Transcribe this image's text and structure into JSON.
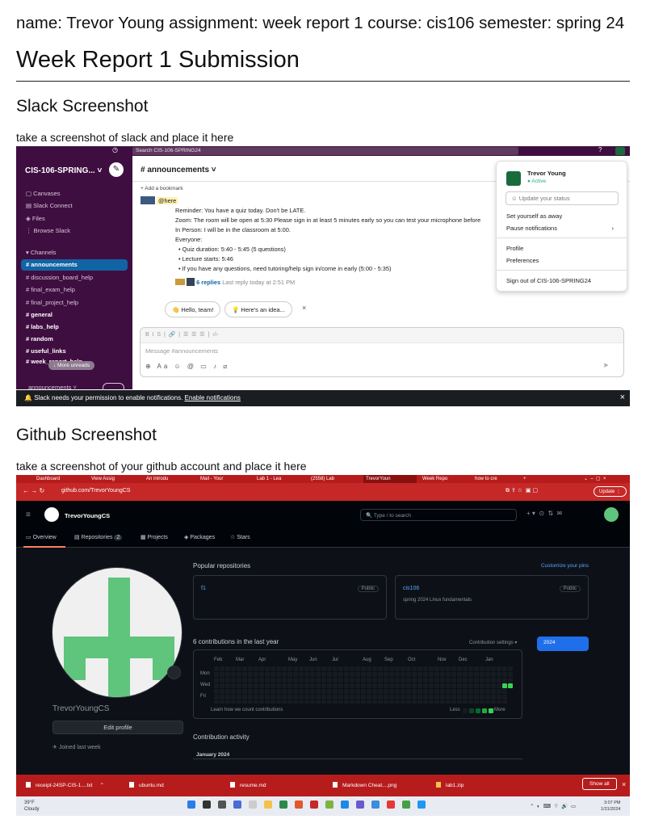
{
  "meta_line": "name: Trevor Young assignment: week report 1 course: cis106 semester: spring 24",
  "title": "Week Report 1 Submission",
  "slack_section": {
    "heading": "Slack Screenshot",
    "caption": "take a screenshot of slack and place it here",
    "search": "Search CIS-106-SPRING24",
    "workspace": "CIS-106-SPRING... ˅",
    "sidebar_top": [
      "Canvases",
      "Slack Connect",
      "Files",
      "Browse Slack"
    ],
    "channels_label": "Channels",
    "channels": [
      "announcements",
      "discussion_board_help",
      "final_exam_help",
      "final_project_help",
      "general",
      "labs_help",
      "random",
      "useful_links",
      "week_report_help"
    ],
    "more_unreads": "↓ More unreads",
    "bottom_label": "announcements ˅",
    "channel_title": "# announcements ˅",
    "add_bookmark": "+ Add a bookmark",
    "message": {
      "here": "@here",
      "lines": [
        "Reminder: You have a quiz today. Don't be LATE.",
        "Zoom: The room will be open at  5:30 Please sign in at least 5 minutes early so you can test your microphone before",
        "In Person: I will be in the classroom at 5:00.",
        "Everyone:",
        "•  Quiz duration: 5:40 - 5:45 (5 questions)",
        "•  Lecture starts: 5:46",
        "•  If you have any questions, need tutoring/help sign in/come in early (5:00 - 5:35)"
      ],
      "replies": "6 replies",
      "last_reply": "Last reply today at 2:51 PM"
    },
    "chips": [
      "👋 Hello, team!",
      "💡 Here's an idea..."
    ],
    "composer_placeholder": "Message #announcements",
    "profile": {
      "name": "Trevor Young",
      "status": "● Active",
      "update_status": "Update your status",
      "set_away": "Set yourself as away",
      "pause": "Pause notifications",
      "profile": "Profile",
      "preferences": "Preferences",
      "sign_out": "Sign out of CIS-106-SPRING24"
    },
    "notice": "Slack needs your permission to enable notifications.",
    "notice_link": "Enable notifications"
  },
  "github_section": {
    "heading": "Github Screenshot",
    "caption": "take a screenshot of your github account and place it here",
    "tabs": [
      "Dashboard",
      "View Assig",
      "An introdu",
      "Mail - Your",
      "Lab 1 - Lea",
      "(2558) Lab",
      "TrevorYoun",
      "Week Repo",
      "how to cre"
    ],
    "url": "github.com/TrevorYoungCS",
    "update": "Update ⋮",
    "username": "TrevorYoungCS",
    "search": "Type / to search",
    "nav": [
      "Overview",
      "Repositories",
      "Projects",
      "Packages",
      "Stars"
    ],
    "repo_count": "2",
    "profile_name": "TrevorYoungCS",
    "edit_profile": "Edit profile",
    "joined": "Joined last week",
    "popular": "Popular repositories",
    "customize": "Customize your pins",
    "repos": [
      {
        "name": "f1",
        "visibility": "Public",
        "desc": ""
      },
      {
        "name": "cis106",
        "visibility": "Public",
        "desc": "spring 2024 Linux fundamentals"
      }
    ],
    "contrib_title": "6 contributions in the last year",
    "contrib_settings": "Contribution settings ▾",
    "year": "2024",
    "months": [
      "Feb",
      "Mar",
      "Apr",
      "May",
      "Jun",
      "Jul",
      "Aug",
      "Sep",
      "Oct",
      "Nov",
      "Dec",
      "Jan"
    ],
    "days": [
      "Mon",
      "Wed",
      "Fri"
    ],
    "learn": "Learn how we count contributions",
    "less": "Less",
    "more": "More",
    "activity": "Contribution activity",
    "january": "January 2024",
    "downloads": [
      "receipt-24SP-CIS-1....txt",
      "ubuntu.md",
      "resume.md",
      "Markdown Cheat....png",
      "lab1.zip"
    ],
    "show_all": "Show all",
    "weather_temp": "39°F",
    "weather_cond": "Cloudy",
    "time": "3:07 PM",
    "date": "1/31/2024",
    "colors": {
      "header_red": "#b71c1c",
      "contrib_green": "#39d353",
      "accent_blue": "#1f6feb"
    }
  }
}
